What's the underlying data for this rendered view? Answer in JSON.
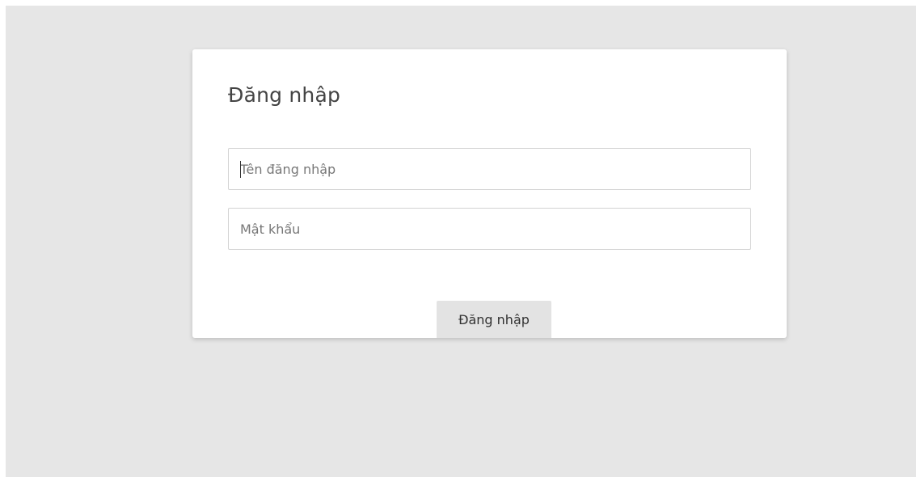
{
  "login": {
    "title": "Đăng nhập",
    "username": {
      "value": "",
      "placeholder": "Tên đăng nhập"
    },
    "password": {
      "value": "",
      "placeholder": "Mật khẩu"
    },
    "submit_label": "Đăng nhập"
  },
  "colors": {
    "background": "#e6e6e6",
    "card": "#ffffff",
    "button": "#e3e3e3",
    "text": "#444444",
    "border": "#d3d3d3"
  }
}
